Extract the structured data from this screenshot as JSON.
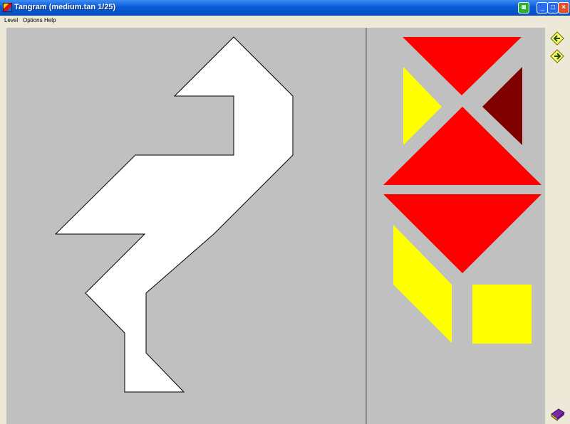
{
  "window": {
    "title": "Tangram (medium.tan    1/25)",
    "controls": [
      "green-icon",
      "minimize-icon",
      "maximize-icon",
      "close-icon"
    ]
  },
  "menu": {
    "items": [
      "Level",
      "Options",
      "Help"
    ]
  },
  "colors": {
    "board": "#c0c0c0",
    "silhouette": "#ffffff",
    "red": "#ff0000",
    "yellow": "#ffff00",
    "dark_red": "#800000"
  },
  "icons": {
    "prev": "arrow-left-icon",
    "next": "arrow-right-icon",
    "help": "book-icon"
  }
}
